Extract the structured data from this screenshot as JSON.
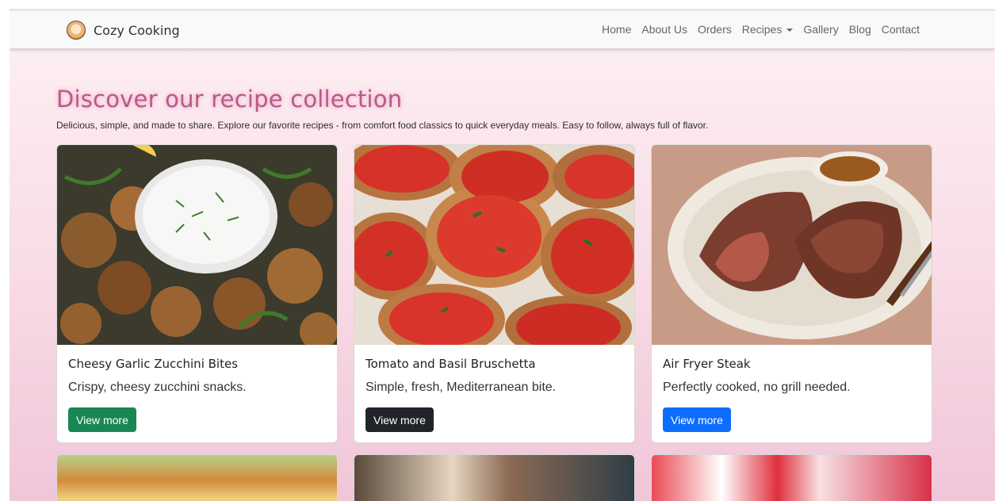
{
  "brand": {
    "name": "Cozy Cooking",
    "logo_icon": "bun-logo-icon"
  },
  "nav": {
    "items": [
      "Home",
      "About Us",
      "Orders",
      "Recipes",
      "Gallery",
      "Blog",
      "Contact"
    ],
    "dropdown_item": "Recipes"
  },
  "hero": {
    "title": "Discover our recipe collection",
    "subtitle": "Delicious, simple, and made to share. Explore our favorite recipes - from comfort food classics to quick everyday meals. Easy to follow, always full of flavor."
  },
  "cards": [
    {
      "title": "Cheesy Garlic Zucchini Bites",
      "description": "Crispy, cheesy zucchini snacks.",
      "button": "View more",
      "button_color": "#198754",
      "image": "zucchini-bites-image"
    },
    {
      "title": "Tomato and Basil Bruschetta",
      "description": "Simple, fresh, Mediterranean bite.",
      "button": "View more",
      "button_color": "#212529",
      "image": "bruschetta-image"
    },
    {
      "title": "Air Fryer Steak",
      "description": "Perfectly cooked, no grill needed.",
      "button": "View more",
      "button_color": "#0d6efd",
      "image": "steak-image"
    }
  ],
  "colors": {
    "title": "#b85a86",
    "background_top": "#fdf1f3",
    "background_bottom": "#f0c6d9"
  }
}
